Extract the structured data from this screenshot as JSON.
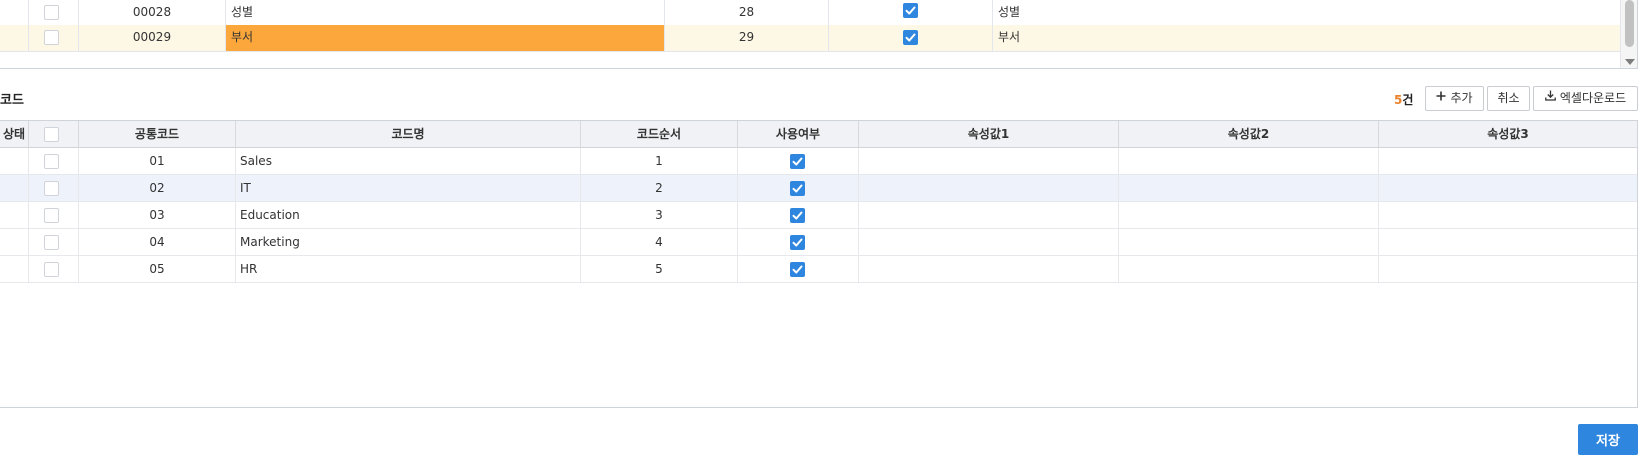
{
  "upper_grid": {
    "rows": [
      {
        "code": "00028",
        "name": "성별",
        "order": "28",
        "used": true,
        "attr": "성별"
      },
      {
        "code": "00029",
        "name": "부서",
        "order": "29",
        "used": true,
        "attr": "부서"
      }
    ]
  },
  "section": {
    "title": "코드",
    "count_number": "5",
    "count_unit": "건"
  },
  "toolbar": {
    "add_label": "추가",
    "cancel_label": "취소",
    "excel_label": "엑셀다운로드"
  },
  "lower_grid": {
    "headers": {
      "status": "상태",
      "code": "공통코드",
      "name": "코드명",
      "order": "코드순서",
      "used": "사용여부",
      "attr1": "속성값1",
      "attr2": "속성값2",
      "attr3": "속성값3"
    },
    "rows": [
      {
        "code": "01",
        "name": "Sales",
        "order": "1",
        "used": true
      },
      {
        "code": "02",
        "name": "IT",
        "order": "2",
        "used": true
      },
      {
        "code": "03",
        "name": "Education",
        "order": "3",
        "used": true
      },
      {
        "code": "04",
        "name": "Marketing",
        "order": "4",
        "used": true
      },
      {
        "code": "05",
        "name": "HR",
        "order": "5",
        "used": true
      }
    ]
  },
  "footer": {
    "save_label": "저장"
  },
  "colors": {
    "accent": "#2f86de",
    "highlight_orange": "#fca73b",
    "count_orange": "#e9822b",
    "selected_row": "#fdf8e6"
  }
}
